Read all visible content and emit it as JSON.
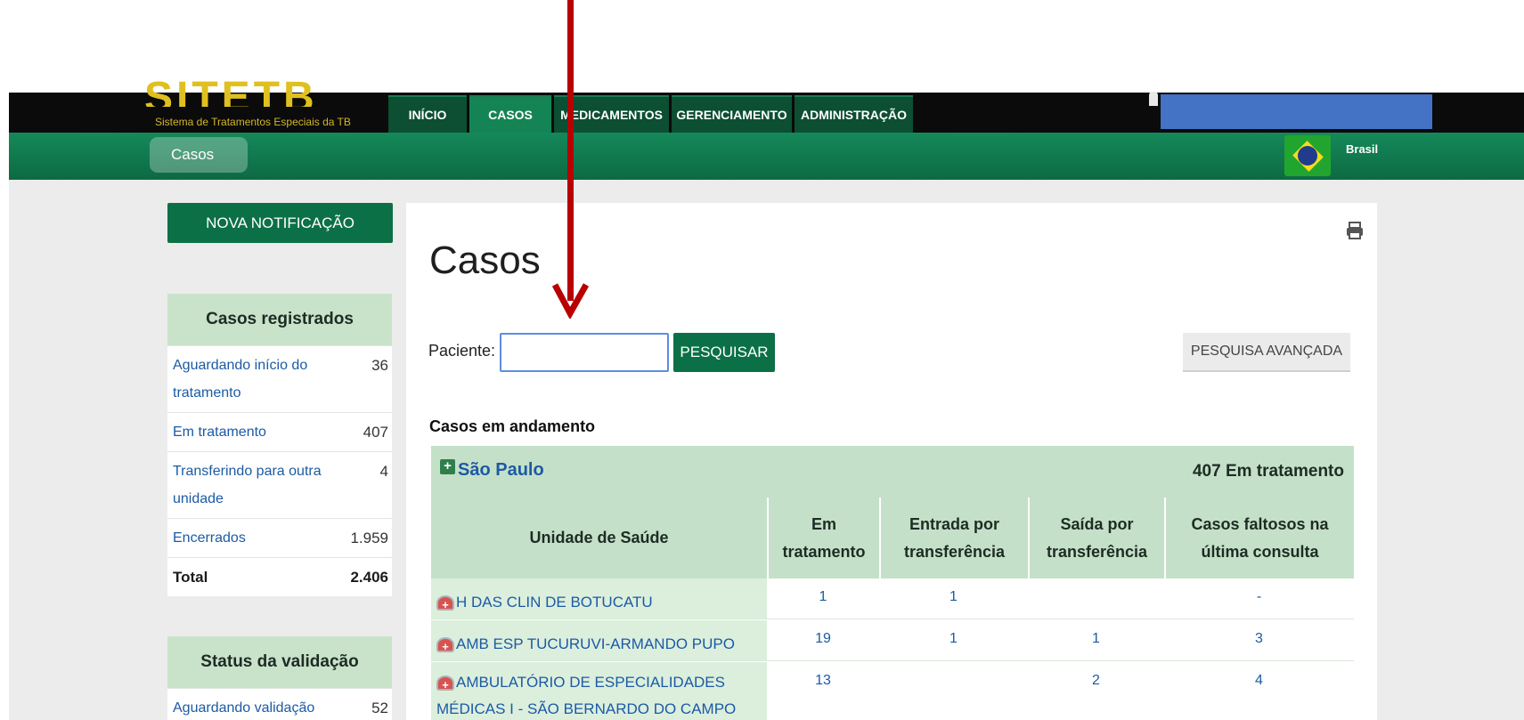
{
  "app": {
    "logo_text": "SITETB",
    "logo_subtitle": "Sistema de Tratamentos Especiais da TB"
  },
  "nav": {
    "tabs": [
      {
        "label": "INÍCIO"
      },
      {
        "label": "CASOS"
      },
      {
        "label": "MEDICAMENTOS"
      },
      {
        "label": "GERENCIAMENTO"
      },
      {
        "label": "ADMINISTRAÇÃO"
      }
    ],
    "active_tab": "CASOS",
    "country": "Brasil"
  },
  "breadcrumb": {
    "label": "Casos"
  },
  "sidebar": {
    "new_button": "NOVA NOTIFICAÇÃO",
    "registered": {
      "title": "Casos registrados",
      "rows": [
        {
          "label": "Aguardando início do tratamento",
          "count": "36"
        },
        {
          "label": "Em tratamento",
          "count": "407"
        },
        {
          "label": "Transferindo para outra unidade",
          "count": "4"
        },
        {
          "label": "Encerrados",
          "count": "1.959"
        }
      ],
      "total_label": "Total",
      "total_count": "2.406"
    },
    "validation": {
      "title": "Status da validação",
      "rows": [
        {
          "label": "Aguardando validação",
          "count": "52"
        }
      ]
    }
  },
  "main": {
    "title": "Casos",
    "search_label": "Paciente:",
    "search_value": "",
    "search_button": "PESQUISAR",
    "advanced_button": "PESQUISA AVANÇADA",
    "section_title": "Casos em andamento",
    "region": {
      "name": "São Paulo",
      "summary": "407 Em tratamento"
    },
    "table": {
      "headers": [
        "Unidade de Saúde",
        "Em tratamento",
        "Entrada por transferência",
        "Saída por transferência",
        "Casos faltosos na última consulta"
      ],
      "rows": [
        {
          "unit": "H DAS CLIN DE BOTUCATU",
          "em_tratamento": "1",
          "entrada": "1",
          "saida": "",
          "faltosos": "-"
        },
        {
          "unit": "AMB ESP TUCURUVI-ARMANDO PUPO",
          "em_tratamento": "19",
          "entrada": "1",
          "saida": "1",
          "faltosos": "3"
        },
        {
          "unit": "AMBULATÓRIO DE ESPECIALIDADES MÉDICAS I - SÃO BERNARDO DO CAMPO",
          "em_tratamento": "13",
          "entrada": "",
          "saida": "2",
          "faltosos": "4"
        }
      ]
    }
  },
  "icons": {
    "print": "print-icon",
    "region_expand": "plus-square-icon",
    "unit": "health-unit-icon",
    "user": "user-icon",
    "flag": "brazil-flag-icon",
    "annotation": "red-arrow"
  },
  "colors": {
    "primary_green": "#0c7046",
    "header_green": "#c5e0c8",
    "link_blue": "#1c5aa4",
    "annotation_red": "#b80000",
    "redacted_blue": "#4472c4"
  }
}
